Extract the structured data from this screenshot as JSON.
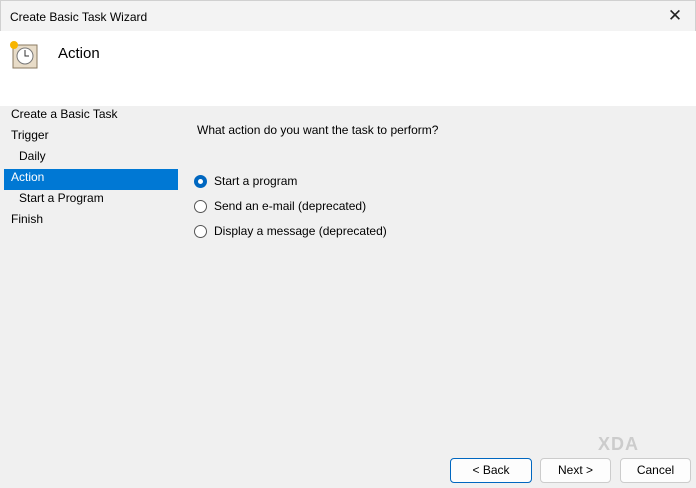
{
  "window": {
    "title": "Create Basic Task Wizard",
    "close": "✕"
  },
  "header": {
    "title": "Action"
  },
  "sidebar": {
    "items": [
      {
        "label": "Create a Basic Task"
      },
      {
        "label": "Trigger"
      },
      {
        "label": "Daily"
      },
      {
        "label": "Action"
      },
      {
        "label": "Start a Program"
      },
      {
        "label": "Finish"
      }
    ]
  },
  "main": {
    "question": "What action do you want the task to perform?",
    "options": [
      {
        "label": "Start a program",
        "selected": true
      },
      {
        "label": "Send an e-mail (deprecated)",
        "selected": false
      },
      {
        "label": "Display a message (deprecated)",
        "selected": false
      }
    ]
  },
  "buttons": {
    "back": "< Back",
    "next": "Next >",
    "cancel": "Cancel"
  },
  "watermark": "XDA",
  "colors": {
    "accent": "#0078d4"
  }
}
